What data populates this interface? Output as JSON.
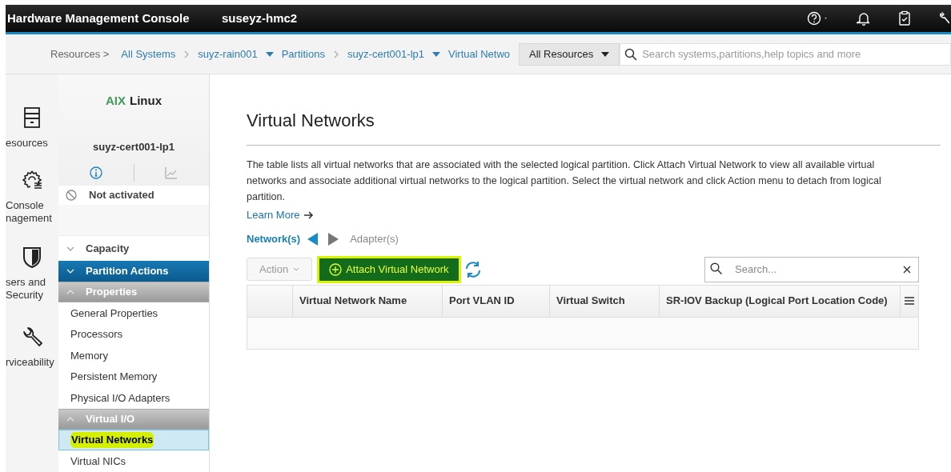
{
  "header": {
    "title": "Hardware Management Console",
    "host": "suseyz-hmc2"
  },
  "breadcrumb": [
    {
      "label": "Resources >",
      "kind": "static"
    },
    {
      "label": "All Systems",
      "kind": "chevron"
    },
    {
      "label": "suyz-rain001",
      "kind": "dropdown"
    },
    {
      "label": "Partitions",
      "kind": "chevron"
    },
    {
      "label": "suyz-cert001-lp1",
      "kind": "dropdown"
    },
    {
      "label": "Virtual Netwo",
      "kind": "cut"
    }
  ],
  "global_search": {
    "scope": "All Resources",
    "placeholder": "Search systems,partitions,help topics and more"
  },
  "nav_rail": [
    {
      "kind": "server",
      "lines": [
        "esources"
      ]
    },
    {
      "kind": "gear",
      "lines": [
        "Console",
        "nagement"
      ]
    },
    {
      "kind": "shield",
      "lines": [
        "sers and",
        "Security"
      ]
    },
    {
      "kind": "wrench",
      "lines": [
        "rviceability"
      ]
    }
  ],
  "sidebar": {
    "os_badges": [
      {
        "label": "AIX",
        "color": "#3f9a5c"
      },
      {
        "label": "Linux",
        "color": "#222222"
      }
    ],
    "partition": "suyz-cert001-lp1",
    "status": "Not activated",
    "sections": [
      {
        "label": "Capacity",
        "kind": "plain",
        "expanded": false
      },
      {
        "label": "Partition Actions",
        "kind": "primary",
        "expanded": false
      },
      {
        "label": "Properties",
        "kind": "group",
        "expanded": true,
        "items": [
          {
            "label": "General Properties",
            "selected": false,
            "highlighted": false
          },
          {
            "label": "Processors",
            "selected": false,
            "highlighted": false
          },
          {
            "label": "Memory",
            "selected": false,
            "highlighted": false
          },
          {
            "label": "Persistent Memory",
            "selected": false,
            "highlighted": false
          },
          {
            "label": "Physical I/O Adapters",
            "selected": false,
            "highlighted": false
          }
        ]
      },
      {
        "label": "Virtual I/O",
        "kind": "group",
        "expanded": true,
        "items": [
          {
            "label": "Virtual Networks",
            "selected": true,
            "highlighted": true
          },
          {
            "label": "Virtual NICs",
            "selected": false,
            "highlighted": false
          }
        ]
      }
    ]
  },
  "main": {
    "title": "Virtual Networks",
    "description": "The table lists all virtual networks that are associated with the selected logical partition. Click Attach Virtual Network to view all available virtual networks and associate additional virtual networks to the logical partition. Select the virtual network and click Action menu to detach from logical partition.",
    "learn_more": "Learn More",
    "views": [
      {
        "label": "Network(s)",
        "selected": true
      },
      {
        "label": "Adapter(s)",
        "selected": false
      }
    ],
    "action_button": {
      "label": "Action",
      "disabled": true
    },
    "attach_button": {
      "label": "Attach Virtual Network",
      "highlighted": true
    },
    "table_search": {
      "placeholder": "Search..."
    },
    "columns": [
      "Virtual Network Name",
      "Port VLAN ID",
      "Virtual Switch",
      "SR-IOV Backup (Logical Port Location Code)"
    ]
  }
}
